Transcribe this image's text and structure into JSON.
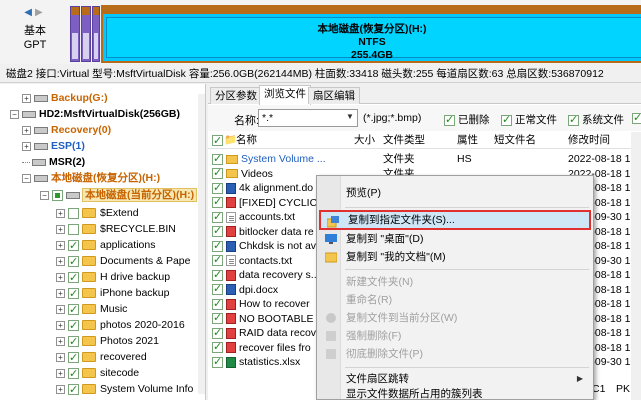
{
  "nav": {
    "line1": "基本",
    "line2": "GPT"
  },
  "partition_bar": {
    "name": "本地磁盘(恢复分区)(H:)",
    "fs": "NTFS",
    "size": "255.4GB"
  },
  "disk_info": "磁盘2 接口:Virtual  型号:MsftVirtualDisk  容量:256.0GB(262144MB)  柱面数:33418  磁头数:255  每道扇区数:63  总扇区数:536870912",
  "tree": {
    "backup": "Backup(G:)",
    "hd2": "HD2:MsftVirtualDisk(256GB)",
    "recovery": "Recovery(0)",
    "esp": "ESP(1)",
    "msr": "MSR(2)",
    "local": "本地磁盘(恢复分区)(H:)",
    "local_current": "本地磁盘(当前分区)(H:)",
    "children": [
      "$Extend",
      "$RECYCLE.BIN",
      "applications",
      "Documents & Pape",
      "H drive backup",
      "iPhone backup",
      "Music",
      "photos 2020-2016",
      "Photos 2021",
      "recovered",
      "sitecode",
      "System Volume Info"
    ]
  },
  "tabs": [
    "分区参数",
    "浏览文件",
    "扇区编辑"
  ],
  "filter": {
    "name_label": "名称:",
    "name_value": "*.*",
    "ext_hint": "(*.jpg;*.bmp)",
    "deleted": "已删除",
    "normal": "正常文件",
    "system": "系统文件"
  },
  "columns": {
    "name": "名称",
    "size": "大小",
    "type": "文件类型",
    "attr": "属性",
    "short": "短文件名",
    "mtime": "修改时间"
  },
  "files": [
    {
      "name": "System Volume ...",
      "type": "文件夹",
      "attr": "HS",
      "mtime": "2022-08-18 16:"
    },
    {
      "name": "Videos",
      "type": "文件夹",
      "attr": "",
      "mtime": "2022-08-18 17:"
    },
    {
      "name": "4k alignment.do",
      "type": "",
      "attr": "",
      "mtime": "2022-08-18 17:"
    },
    {
      "name": "[FIXED] CYCLIC ...",
      "type": "",
      "attr": "",
      "mtime": "2022-08-18 17:"
    },
    {
      "name": "accounts.txt",
      "type": "",
      "attr": "",
      "mtime": "2022-09-30 10:"
    },
    {
      "name": "bitlocker data re",
      "type": "",
      "attr": "",
      "mtime": "2022-08-18 17:"
    },
    {
      "name": "Chkdsk is not av",
      "type": "",
      "attr": "",
      "mtime": "2022-08-18 17:"
    },
    {
      "name": "contacts.txt",
      "type": "",
      "attr": "",
      "mtime": "2022-09-30 10:"
    },
    {
      "name": "data recovery s...",
      "type": "",
      "attr": "",
      "mtime": "2022-08-18 17:"
    },
    {
      "name": "dpi.docx",
      "type": "",
      "attr": "",
      "mtime": "2022-08-18 17:"
    },
    {
      "name": "How to recover",
      "type": "",
      "attr": "",
      "mtime": "2022-08-18 17:"
    },
    {
      "name": "NO BOOTABLE ...",
      "type": "",
      "attr": "",
      "mtime": "2022-08-18 17:"
    },
    {
      "name": "RAID data recov",
      "type": "",
      "attr": "",
      "mtime": "2022-08-18 17:"
    },
    {
      "name": "recover files fro",
      "type": "",
      "attr": "",
      "mtime": "2022-08-18 17:"
    },
    {
      "name": "statistics.xlsx",
      "type": "",
      "attr": "",
      "mtime": "2022-09-30 10:"
    }
  ],
  "bottom_partial": {
    "c1": "C1",
    "c2": "PK"
  },
  "context_menu": {
    "preview": "预览(P)",
    "copy_to_folder": "复制到指定文件夹(S)...",
    "copy_desktop": "复制到 \"桌面\"(D)",
    "copy_mydocs": "复制到 \"我的文档\"(M)",
    "new_folder": "新建文件夹(N)",
    "rename": "重命名(R)",
    "copy_current": "复制文件到当前分区(W)",
    "force_delete": "强制删除(F)",
    "wipe_delete": "彻底删除文件(P)",
    "sector_jump": "文件扇区跳转",
    "show_clusters": "显示文件数据所占用的簇列表"
  }
}
